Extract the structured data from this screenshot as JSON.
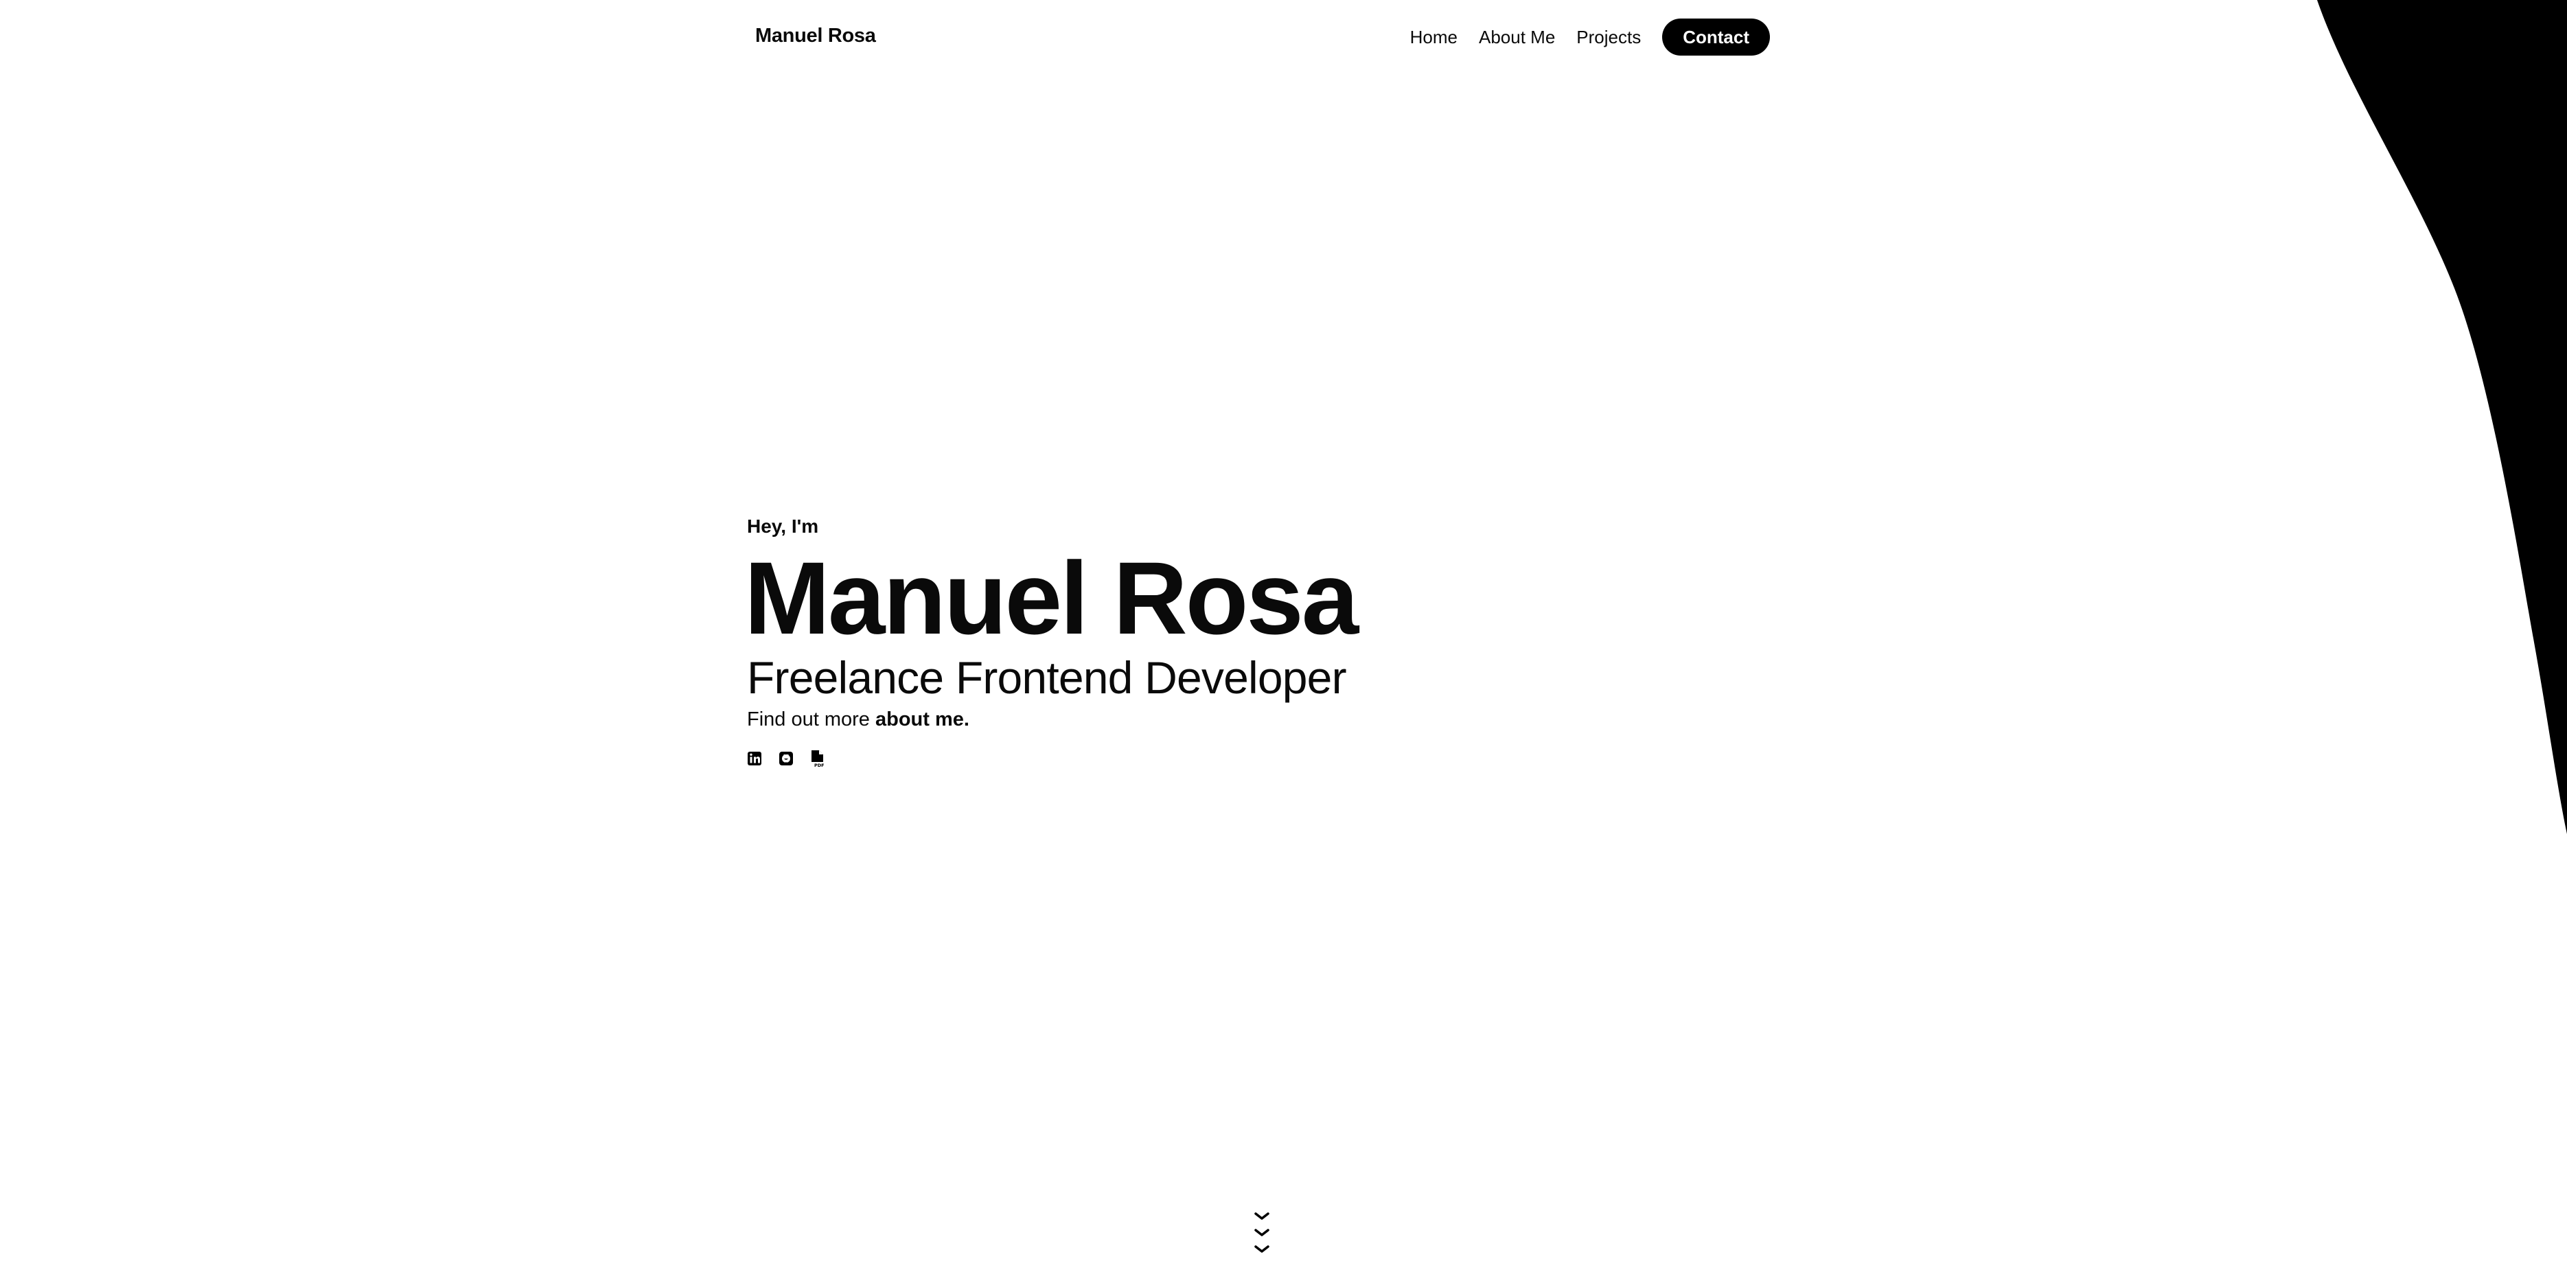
{
  "nav": {
    "brand": "Manuel Rosa",
    "links": [
      "Home",
      "About Me",
      "Projects"
    ],
    "contact": "Contact"
  },
  "hero": {
    "greeting": "Hey, I'm",
    "name": "Manuel Rosa",
    "role": "Freelance Frontend Developer",
    "more_prefix": "Find out more ",
    "more_link": "about me."
  },
  "socials": [
    {
      "icon": "linkedin-icon"
    },
    {
      "icon": "github-icon"
    },
    {
      "icon": "pdf-icon"
    }
  ],
  "scroll_hint": {
    "icon": "chevron-down-icon"
  },
  "colors": {
    "background": "#ffffff",
    "text": "#0a0a0a",
    "accent": "#000000"
  }
}
